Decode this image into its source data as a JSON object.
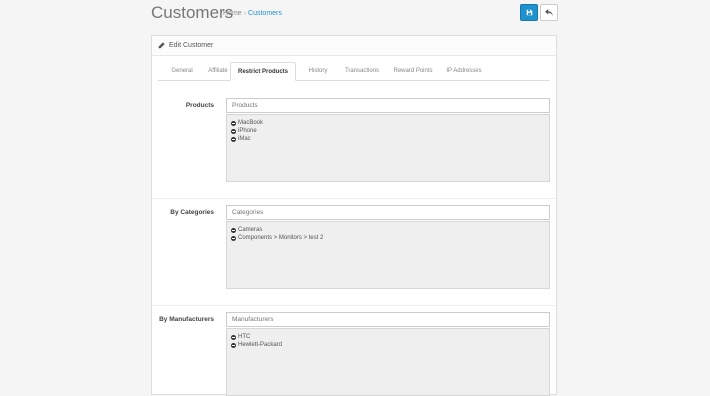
{
  "header": {
    "title": "Customers",
    "breadcrumb": {
      "home": "Home",
      "separator": "›",
      "current": "Customers"
    },
    "save_icon": "save-icon",
    "back_icon": "reply-icon"
  },
  "panel": {
    "heading": "Edit Customer",
    "heading_icon": "pencil-icon",
    "tabs": [
      "General",
      "Affiliate",
      "Restrict Products",
      "History",
      "Transactions",
      "Reward Points",
      "IP Addresses"
    ],
    "active_tab": "Restrict Products"
  },
  "sections": {
    "products": {
      "label": "Products",
      "placeholder": "Products",
      "items": [
        "MacBook",
        "iPhone",
        "iMac"
      ]
    },
    "categories": {
      "label": "By Categories",
      "placeholder": "Categories",
      "items": [
        "Cameras",
        "Components > Monitors > test 2"
      ]
    },
    "manufacturers": {
      "label": "By Manufacturers",
      "placeholder": "Manufacturers",
      "items": [
        "HTC",
        "Hewlett-Packard"
      ]
    }
  },
  "colors": {
    "primary": "#1e91cf",
    "well": "#efefef"
  }
}
